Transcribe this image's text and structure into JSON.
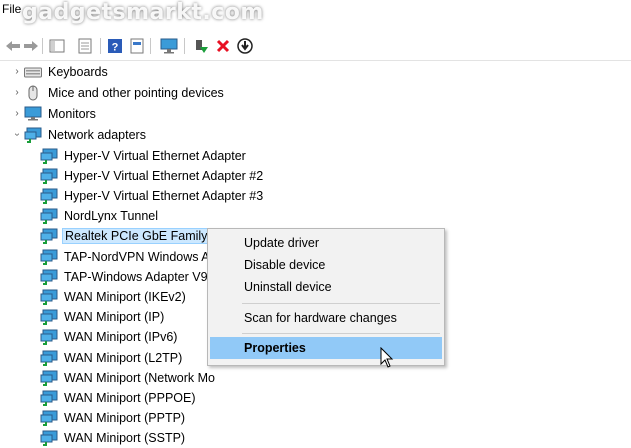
{
  "watermark": "gadgetsmarkt.com",
  "menubar": {
    "file_label": "File"
  },
  "toolbar": {
    "buttons": [
      "back-icon",
      "forward-icon",
      "show-hide-tree-icon",
      "properties-icon",
      "help-icon",
      "monitor-icon",
      "enable-device-icon",
      "uninstall-icon",
      "update-driver-icon"
    ]
  },
  "tree": {
    "categories": [
      {
        "label": "Keyboards",
        "icon": "keyboard-icon",
        "expanded": false
      },
      {
        "label": "Mice and other pointing devices",
        "icon": "mouse-icon",
        "expanded": false
      },
      {
        "label": "Monitors",
        "icon": "monitor-icon",
        "expanded": false
      },
      {
        "label": "Network adapters",
        "icon": "network-adapter-icon",
        "expanded": true
      }
    ],
    "network_adapters": [
      "Hyper-V Virtual Ethernet Adapter",
      "Hyper-V Virtual Ethernet Adapter #2",
      "Hyper-V Virtual Ethernet Adapter #3",
      "NordLynx Tunnel",
      "Realtek PCIe GbE Family Controller",
      "TAP-NordVPN Windows Ada",
      "TAP-Windows Adapter V9",
      "WAN Miniport (IKEv2)",
      "WAN Miniport (IP)",
      "WAN Miniport (IPv6)",
      "WAN Miniport (L2TP)",
      "WAN Miniport (Network Mo",
      "WAN Miniport (PPPOE)",
      "WAN Miniport (PPTP)",
      "WAN Miniport (SSTP)"
    ],
    "selected_adapter": "Realtek PCIe GbE Family Controller"
  },
  "context_menu": {
    "items": [
      "Update driver",
      "Disable device",
      "Uninstall device",
      "Scan for hardware changes",
      "Properties"
    ],
    "highlighted": "Properties"
  },
  "colors": {
    "selection": "#cce8ff",
    "menu_hover": "#91c9f7",
    "uninstall_red": "#e81123"
  }
}
